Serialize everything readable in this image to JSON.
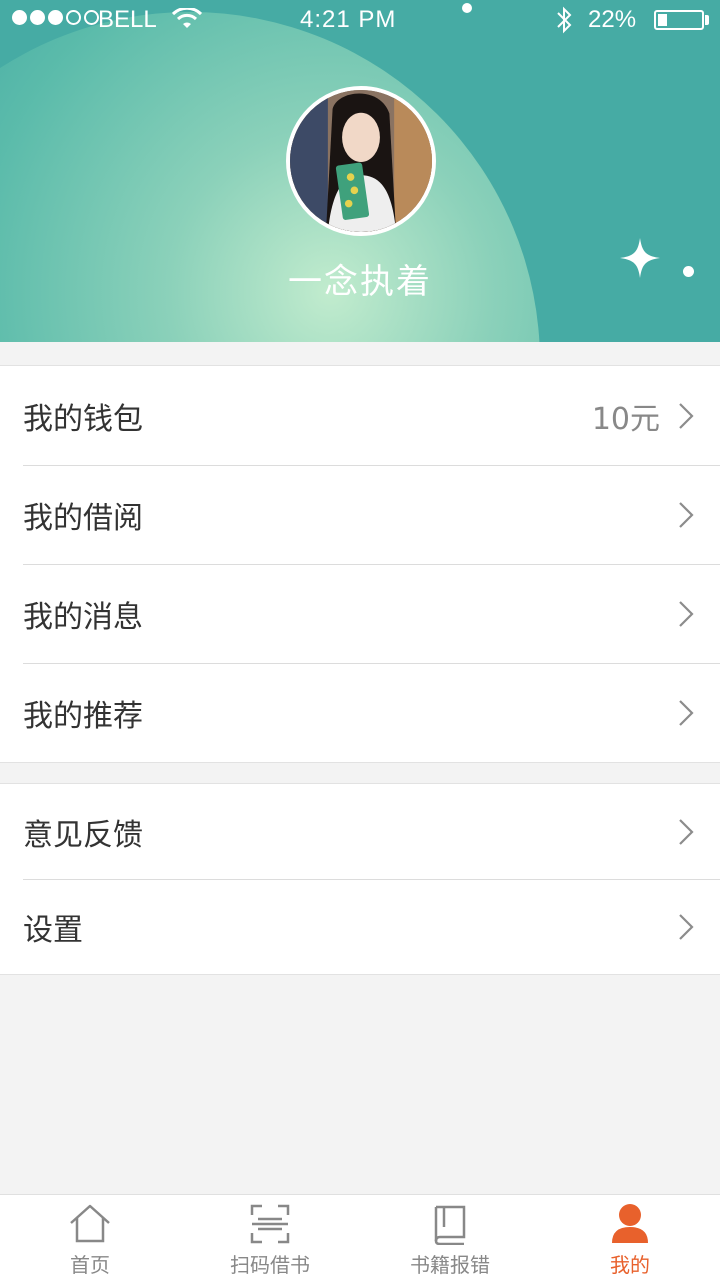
{
  "status_bar": {
    "carrier": "BELL",
    "time": "4:21 PM",
    "battery": "22%",
    "battery_level": 0.22,
    "signal_bars_filled": 3,
    "signal_bars_total": 5
  },
  "profile": {
    "username": "一念执着"
  },
  "menu": {
    "group1": [
      {
        "label": "我的钱包",
        "value": "10元"
      },
      {
        "label": "我的借阅",
        "value": ""
      },
      {
        "label": "我的消息",
        "value": ""
      },
      {
        "label": "我的推荐",
        "value": ""
      }
    ],
    "group2": [
      {
        "label": "意见反馈",
        "value": ""
      },
      {
        "label": "设置",
        "value": ""
      }
    ]
  },
  "tabbar": {
    "tabs": [
      {
        "label": "首页",
        "icon": "home-icon",
        "active": false
      },
      {
        "label": "扫码借书",
        "icon": "scan-icon",
        "active": false
      },
      {
        "label": "书籍报错",
        "icon": "book-icon",
        "active": false
      },
      {
        "label": "我的",
        "icon": "user-icon",
        "active": true
      }
    ]
  },
  "colors": {
    "header": "#46aba4",
    "accent": "#e8612c",
    "inactive": "#888888"
  }
}
